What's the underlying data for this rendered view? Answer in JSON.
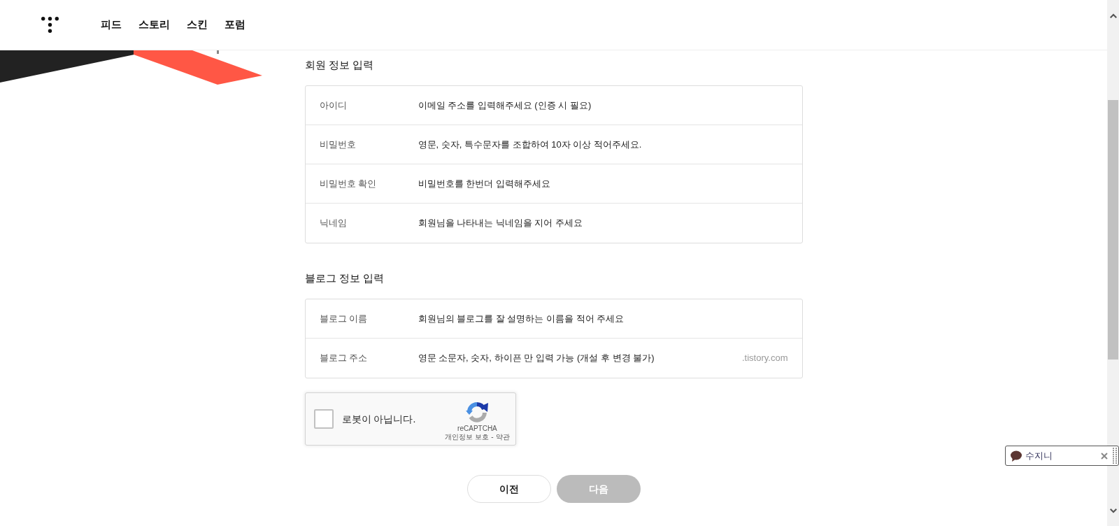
{
  "header": {
    "nav": [
      {
        "label": "피드"
      },
      {
        "label": "스토리"
      },
      {
        "label": "스킨"
      },
      {
        "label": "포럼"
      }
    ]
  },
  "sections": [
    {
      "title": "회원 정보 입력",
      "fields": [
        {
          "label": "아이디",
          "placeholder": "이메일 주소를 입력해주세요 (인증 시 필요)"
        },
        {
          "label": "비밀번호",
          "placeholder": "영문, 숫자, 특수문자를 조합하여 10자 이상 적어주세요."
        },
        {
          "label": "비밀번호 확인",
          "placeholder": "비밀번호를 한번더 입력해주세요"
        },
        {
          "label": "닉네임",
          "placeholder": "회원님을 나타내는 닉네임을 지어 주세요"
        }
      ]
    },
    {
      "title": "블로그 정보 입력",
      "fields": [
        {
          "label": "블로그 이름",
          "placeholder": "회원님의 블로그를 잘 설명하는 이름을 적어 주세요"
        },
        {
          "label": "블로그 주소",
          "placeholder": "영문 소문자, 숫자, 하이픈 만 입력 가능 (개설 후 변경 불가)",
          "suffix": ".tistory.com"
        }
      ]
    }
  ],
  "captcha": {
    "checked": false,
    "label": "로봇이 아닙니다.",
    "brand": "reCAPTCHA",
    "links": [
      {
        "label": "개인정보 보호"
      },
      {
        "label": "약관"
      }
    ],
    "separator": "-"
  },
  "buttons": [
    {
      "label": "이전",
      "disabled": false
    },
    {
      "label": "다음",
      "disabled": true
    }
  ],
  "floating_widget": {
    "text": "수지니"
  }
}
